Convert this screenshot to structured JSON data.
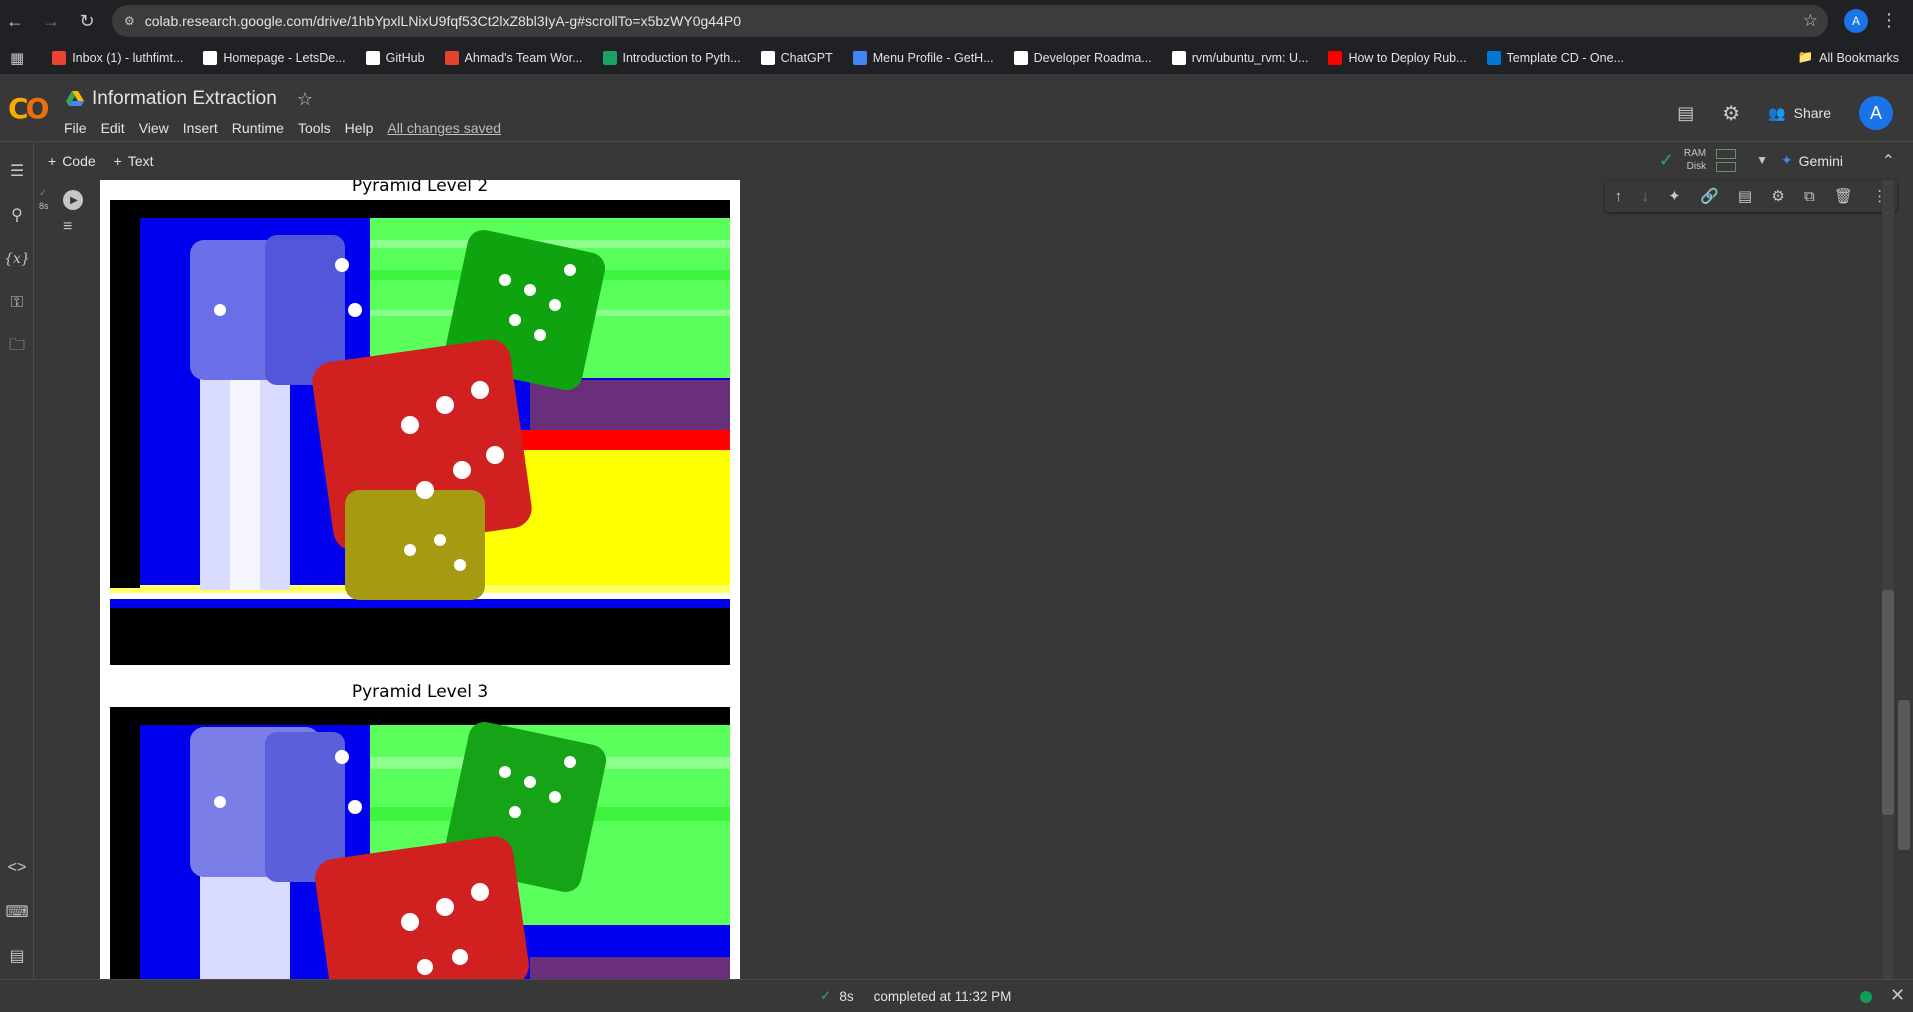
{
  "browser": {
    "url": "colab.research.google.com/drive/1hbYpxlLNixU9fqf53Ct2lxZ8bl3IyA-g#scrollTo=x5bzWY0g44P0",
    "profile_initial": "A",
    "bookmarks": [
      {
        "label": "Inbox (1) - luthfimt...",
        "color": "#ea4335"
      },
      {
        "label": "Homepage - LetsDe...",
        "color": "#ffffff"
      },
      {
        "label": "GitHub",
        "color": "#ffffff"
      },
      {
        "label": "Ahmad's Team Wor...",
        "color": "#e44332"
      },
      {
        "label": "Introduction to Pyth...",
        "color": "#1aa260"
      },
      {
        "label": "ChatGPT",
        "color": "#ffffff"
      },
      {
        "label": "Menu Profile - GetH...",
        "color": "#4285f4"
      },
      {
        "label": "Developer Roadma...",
        "color": "#ffffff"
      },
      {
        "label": "rvm/ubuntu_rvm: U...",
        "color": "#ffffff"
      },
      {
        "label": "How to Deploy Rub...",
        "color": "#ff0000"
      },
      {
        "label": "Template CD - One...",
        "color": "#0078d4"
      }
    ],
    "all_bookmarks": "All Bookmarks"
  },
  "colab": {
    "title": "Information Extraction",
    "menu": [
      "File",
      "Edit",
      "View",
      "Insert",
      "Runtime",
      "Tools",
      "Help"
    ],
    "saved_status": "All changes saved",
    "share_label": "Share",
    "avatar_initial": "A",
    "toolbar": {
      "code_label": "Code",
      "text_label": "Text",
      "ram_label": "RAM",
      "disk_label": "Disk",
      "gemini_label": "Gemini"
    },
    "cell": {
      "exec_time": "8s"
    },
    "output": {
      "titles": [
        "Pyramid Level 2",
        "Pyramid Level 3"
      ]
    },
    "status": {
      "time": "8s",
      "message": "completed at 11:32 PM"
    }
  }
}
